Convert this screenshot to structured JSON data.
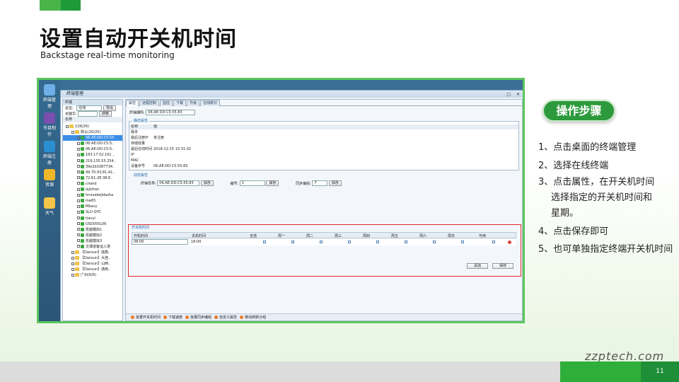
{
  "slide": {
    "title": "设置自动开关机时间",
    "subtitle": "Backstage real-time monitoring",
    "steps_label": "操作步骤",
    "steps": [
      "1、点击桌面的终端管理",
      "2、选择在线终端",
      "3、点击属性，在开关机时间",
      "选择指定的开关机时间和",
      "星期。",
      "4、点击保存即可",
      "5、也可单独指定终端开关机时间"
    ],
    "watermark": "zzptech.com",
    "page_number": "11"
  },
  "screenshot": {
    "desktop_icons": [
      "终端管理",
      "节目制作",
      "终端注册",
      "资源",
      "天气"
    ],
    "window_title": "终端管理",
    "left": {
      "header": "终端",
      "status_label": "状态:",
      "status_value": "在线",
      "export_label": "导出",
      "keyword_label": "关键字:",
      "search_label": "搜索",
      "name_label": "名称",
      "tree": [
        "/(26/26)",
        "默认(20/20)",
        "06:AE:DD:C5:55",
        "06:AE:DD:C5:5..",
        "06:AE:DD:C5:5..",
        "183.17.52.161 ..",
        "219.135.55.254..",
        "39e2b1087734..",
        "49.70.93.81:41..",
        "72:61:2E:38:E..",
        "crland",
        "lajizhan",
        "hnxuekejidasha",
        "me65",
        "Mbavy",
        "SLD-QYC",
        "tianyi",
        "USD055L06",
        "凯越模拟1",
        "凯越模拟2",
        "凯越模拟3",
        "文博道客运入境",
        "【Dansun】独角..",
        "【Dansun】大连..",
        "【Dansun】山西..",
        "【Dansun】通用..",
        "广州(6/6)"
      ]
    },
    "right": {
      "tabs": [
        "属性",
        "远程控制",
        "监控",
        "下载",
        "升级",
        "在线统计"
      ],
      "terminal_code_label": "终端编码:",
      "terminal_code_value": "06:AE:DD:C5:55:83",
      "static_group": "静态属性",
      "static_headers": [
        "名称",
        "值"
      ],
      "static_rows": [
        [
          "版本",
          ""
        ],
        [
          "最后注册IP",
          "未注册"
        ],
        [
          "存储容量",
          ""
        ],
        [
          "最后在线时间",
          "2018-12-15 15:31:02"
        ],
        [
          "IP",
          ""
        ],
        [
          "MAC",
          ""
        ],
        [
          "设备序号",
          "06:AE:DD:C5:55:83"
        ]
      ],
      "dynamic_group": "动态属性",
      "terminal_name_label": "终端名称:",
      "terminal_name_value": "06:AE:DD:C5:55:83",
      "number_label": "编号:",
      "number_value": "1",
      "sync_label": "同步编组:",
      "sync_value": "7",
      "save_label": "保存",
      "schedule_group": "开关机时间",
      "schedule_headers": [
        "开机时间",
        "关机时间",
        "全选",
        "周一",
        "周二",
        "周三",
        "周四",
        "周五",
        "周六",
        "周日",
        "可用"
      ],
      "schedule_row": {
        "on": "08:00",
        "off": "18:00"
      },
      "add_label": "添加",
      "save2_label": "保存",
      "bottom_actions": [
        "批量开关机时间",
        "下载速度",
        "批量同步编组",
        "自定义属性",
        "移动到新分组"
      ]
    }
  }
}
